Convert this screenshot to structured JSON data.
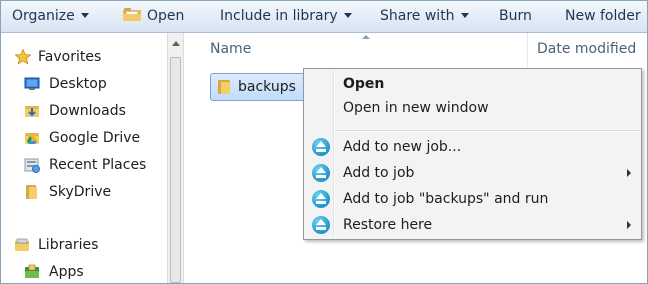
{
  "toolbar": {
    "organize": "Organize",
    "open": "Open",
    "include_in_library": "Include in library",
    "share_with": "Share with",
    "burn": "Burn",
    "new_folder": "New folder"
  },
  "nav": {
    "favorites": "Favorites",
    "favorites_items": [
      "Desktop",
      "Downloads",
      "Google Drive",
      "Recent Places",
      "SkyDrive"
    ],
    "libraries": "Libraries",
    "libraries_items": [
      "Apps"
    ]
  },
  "content": {
    "columns": {
      "name": "Name",
      "date_modified": "Date modified"
    },
    "rows": [
      {
        "name": "backups",
        "selected": true
      }
    ]
  },
  "context_menu": {
    "items": [
      {
        "label": "Open",
        "bold": true,
        "icon": null,
        "submenu": false
      },
      {
        "label": "Open in new window",
        "bold": false,
        "icon": null,
        "submenu": false
      },
      {
        "label": "Add to new job...",
        "bold": false,
        "icon": "eject-icon",
        "submenu": false
      },
      {
        "label": "Add to job",
        "bold": false,
        "icon": "eject-icon",
        "submenu": true
      },
      {
        "label": "Add to job \"backups\" and run",
        "bold": false,
        "icon": "eject-icon",
        "submenu": false
      },
      {
        "label": "Restore here",
        "bold": false,
        "icon": "eject-icon",
        "submenu": true
      }
    ]
  },
  "colors": {
    "toolbar_text": "#1e3557",
    "selection": "#c1dcfc",
    "menu_bg": "#f3f3f3",
    "accent_icon": "#1f95c9"
  }
}
